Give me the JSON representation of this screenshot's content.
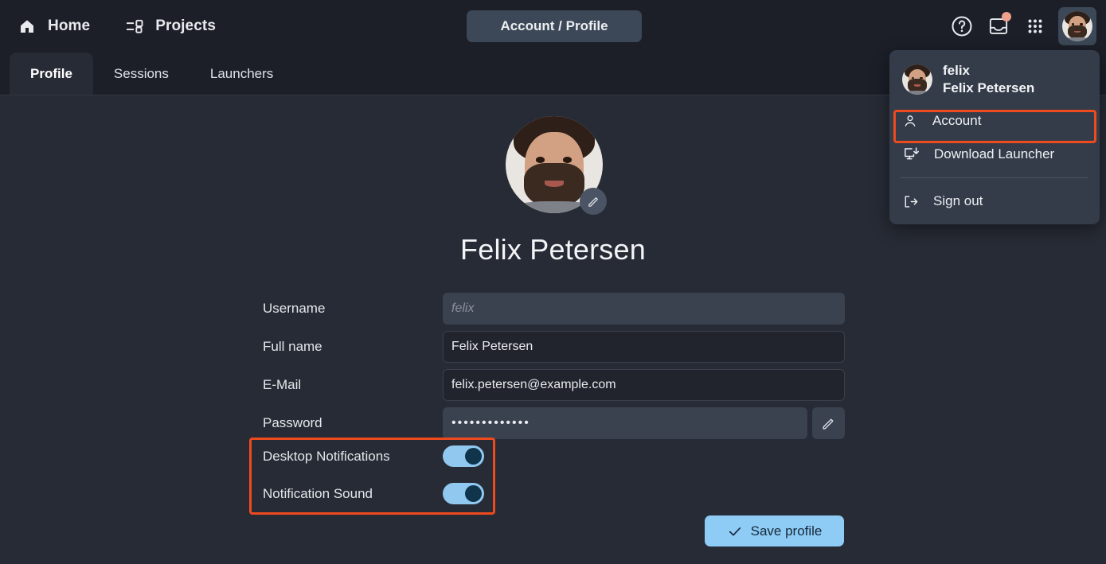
{
  "topbar": {
    "home_label": "Home",
    "home_icon": "home-icon",
    "projects_label": "Projects",
    "projects_icon": "projects-list-icon",
    "center_title": "Account / Profile",
    "help_icon": "question-circle-icon",
    "inbox_icon": "inbox-tray-icon",
    "apps_icon": "apps-grid-icon",
    "avatar_icon": "user-avatar",
    "notification_badge": true
  },
  "tabs": [
    {
      "label": "Profile",
      "active": true
    },
    {
      "label": "Sessions",
      "active": false
    },
    {
      "label": "Launchers",
      "active": false
    }
  ],
  "profile": {
    "display_name": "Felix Petersen",
    "avatar_edit_icon": "pencil-icon",
    "fields": [
      {
        "label": "Username",
        "value": "",
        "placeholder": "felix",
        "disabled": true
      },
      {
        "label": "Full name",
        "value": "Felix Petersen",
        "placeholder": "",
        "disabled": false
      },
      {
        "label": "E-Mail",
        "value": "felix.petersen@example.com",
        "placeholder": "",
        "disabled": false
      },
      {
        "label": "Password",
        "value": "•••••••••••••",
        "placeholder": "",
        "disabled": true
      }
    ],
    "password_edit_icon": "pencil-icon",
    "toggles": [
      {
        "label": "Desktop Notifications",
        "on": true
      },
      {
        "label": "Notification Sound",
        "on": true
      }
    ],
    "save_label": "Save profile",
    "save_icon": "check-icon"
  },
  "user_menu": {
    "username": "felix",
    "fullname": "Felix Petersen",
    "items": [
      {
        "label": "Account",
        "icon": "person-icon",
        "highlighted": true
      },
      {
        "label": "Download Launcher",
        "icon": "monitor-download-icon",
        "highlighted": false
      },
      {
        "label": "Sign out",
        "icon": "sign-out-icon",
        "highlighted": false
      }
    ]
  },
  "colors": {
    "page_bg": "#272b35",
    "bar_bg": "#1c1f28",
    "menu_bg": "#343c4a",
    "accent_blue": "#8ecbf5",
    "toggle_track": "#90c8f0",
    "toggle_knob": "#10344c",
    "annotation_red": "#ef4a1e",
    "notification_dot": "#eda08c",
    "pill_bg": "#3c4857"
  }
}
